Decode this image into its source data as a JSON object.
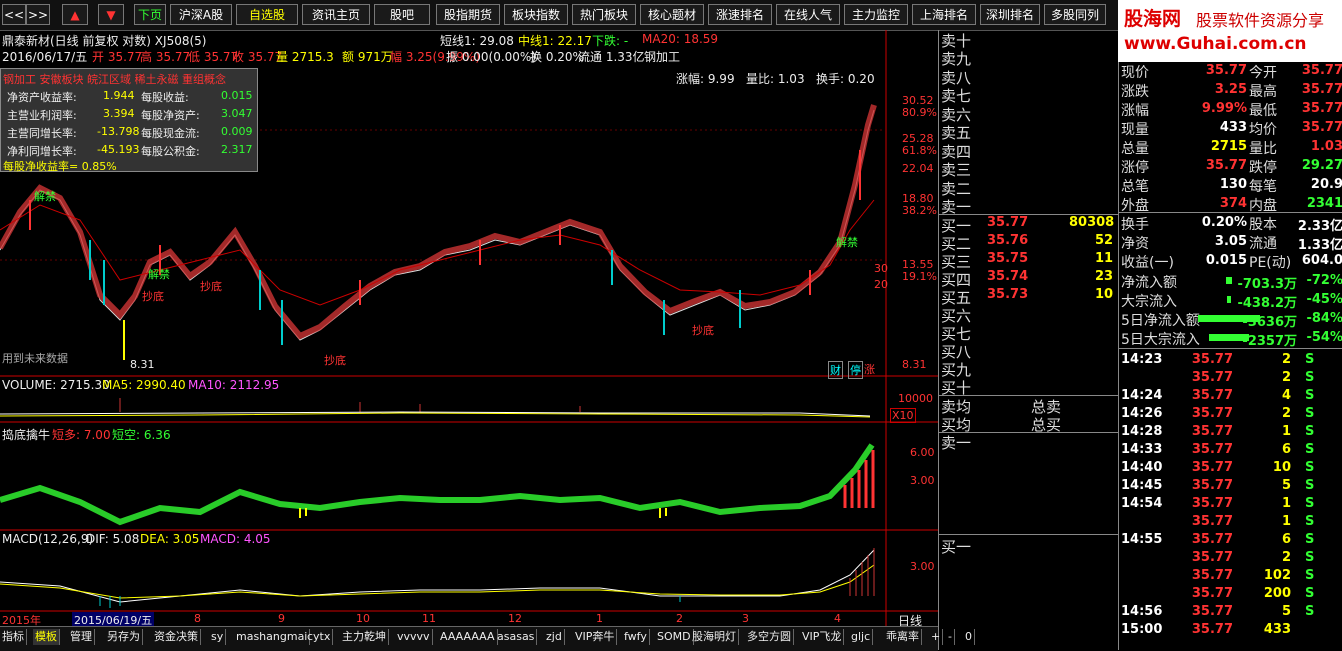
{
  "toolbar": {
    "nav_left": "<<",
    "nav_right": ">>",
    "up": "▲",
    "down": "▼",
    "buttons": [
      "下页",
      "沪深A股",
      "自选股",
      "资讯主页",
      "股吧",
      "股指期货",
      "板块指数",
      "热门板块",
      "核心题材",
      "涨速排名",
      "在线人气",
      "主力监控",
      "上海排名",
      "深圳排名",
      "多股同列"
    ]
  },
  "logo": {
    "brand": "股海网",
    "slogan": "股票软件资源分享",
    "url": "www.Guhai.com.cn"
  },
  "chart": {
    "title": "鼎泰新材(日线 前复权 对数) XJ508(5)",
    "short_line": "短线1: 29.08",
    "mid_line": "中线1: 22.17",
    "down": "下跌: -",
    "ma20": "MA20: 18.59",
    "date_line": "2016/06/17/五",
    "open": "开 35.77",
    "high": "高 35.77",
    "low": "低 35.77",
    "close": "收 35.77",
    "volume_hand": "量 2715.3",
    "amount": "额 971万",
    "range": "幅 3.25(9.99%)",
    "amplitude": "振 0.00(0.00%)",
    "turnover": "换 0.20%",
    "float": "流通 1.33亿",
    "concept": "钢加工",
    "change_rate": "涨幅: 9.99",
    "volume_ratio": "量比: 1.03",
    "turnover2": "换手: 0.20",
    "price_scale": [
      "30.52",
      "25.28",
      "22.04",
      "18.80",
      "13.55",
      "8.31"
    ],
    "pct_scale": [
      "80.9%",
      "61.8%",
      "38.2%",
      "19.1%"
    ],
    "mini_scale": [
      "30",
      "20"
    ],
    "future_note": "用到未来数据",
    "low_mark": "8.31",
    "signals": [
      "解禁",
      "抄底",
      "解禁",
      "抄底",
      "抄底",
      "抄底",
      "解禁"
    ],
    "cai": "财",
    "ting": "停",
    "zhang": "涨",
    "volume_line": "VOLUME: 2715.30",
    "ma5": "MA5: 2990.40",
    "ma10": "MA10: 2112.95",
    "vol_scale": "10000",
    "vol_x": "X10",
    "ind_name": "捣底擒牛",
    "long_short": "短多: 7.00",
    "short_empty": "短空: 6.36",
    "ind_scale": [
      "6.00",
      "3.00"
    ],
    "macd_line": "MACD(12,26,9)",
    "dif": "DIF: 5.08",
    "dea": "DEA: 3.05",
    "macd": "MACD: 4.05",
    "macd_scale": "3.00",
    "x_year": "2015年",
    "x_date": "2015/06/19/五",
    "x_months": [
      "8",
      "9",
      "10",
      "11",
      "12",
      "1",
      "2",
      "3",
      "4"
    ],
    "period": "日线"
  },
  "fin": {
    "header": "钢加工 安徽板块 皖江区域 稀土永磁 重组概念",
    "rows": [
      [
        "净资产收益率:",
        "1.944",
        "每股收益:",
        "0.015"
      ],
      [
        "主营业利润率:",
        "3.394",
        "每股净资产:",
        "3.047"
      ],
      [
        "主营同增长率:",
        "-13.798",
        "每股现金流:",
        "0.009"
      ],
      [
        "净利同增长率:",
        "-45.193",
        "每股公积金:",
        "2.317"
      ]
    ],
    "footer": "每股净收益率= 0.85%"
  },
  "book": {
    "sell_labels": [
      "卖十",
      "卖九",
      "卖八",
      "卖七",
      "卖六",
      "卖五",
      "卖四",
      "卖三",
      "卖二",
      "卖一"
    ],
    "buy_labels": [
      "买一",
      "买二",
      "买三",
      "买四",
      "买五",
      "买六",
      "买七",
      "买八",
      "买九",
      "买十"
    ],
    "buy_prices": [
      "35.77",
      "35.76",
      "35.75",
      "35.74",
      "35.73"
    ],
    "buy_vols": [
      "80308",
      "52",
      "11",
      "23",
      "10"
    ],
    "avg_sell": "卖均",
    "avg_buy": "买均",
    "total_sell": "总卖",
    "total_buy": "总买",
    "mini_sell": "卖一",
    "mini_buy": "买一"
  },
  "quote": {
    "rows": [
      [
        "现价",
        "35.77",
        "今开",
        "35.77"
      ],
      [
        "涨跌",
        "3.25",
        "最高",
        "35.77"
      ],
      [
        "涨幅",
        "9.99%",
        "最低",
        "35.77"
      ],
      [
        "现量",
        "433",
        "均价",
        "35.77"
      ],
      [
        "总量",
        "2715",
        "量比",
        "1.03"
      ],
      [
        "涨停",
        "35.77",
        "跌停",
        "29.27"
      ],
      [
        "总笔",
        "130",
        "每笔",
        "20.9"
      ],
      [
        "外盘",
        "374",
        "内盘",
        "2341"
      ],
      [
        "换手",
        "0.20%",
        "股本",
        "2.33亿"
      ],
      [
        "净资",
        "3.05",
        "流通",
        "1.33亿"
      ],
      [
        "收益(一)",
        "0.015",
        "PE(动)",
        "604.0"
      ]
    ],
    "flows": [
      [
        "净流入额",
        "-703.3万",
        "-72%"
      ],
      [
        "大宗流入",
        "-438.2万",
        "-45%"
      ],
      [
        "5日净流入额",
        "-3636万",
        "-84%"
      ],
      [
        "5日大宗流入",
        "-2357万",
        "-54%"
      ]
    ],
    "ticks": [
      [
        "14:23",
        "35.77",
        "2",
        "S"
      ],
      [
        "",
        "35.77",
        "2",
        "S"
      ],
      [
        "14:24",
        "35.77",
        "4",
        "S"
      ],
      [
        "14:26",
        "35.77",
        "2",
        "S"
      ],
      [
        "14:28",
        "35.77",
        "1",
        "S"
      ],
      [
        "14:33",
        "35.77",
        "6",
        "S"
      ],
      [
        "14:40",
        "35.77",
        "10",
        "S"
      ],
      [
        "14:45",
        "35.77",
        "5",
        "S"
      ],
      [
        "14:54",
        "35.77",
        "1",
        "S"
      ],
      [
        "",
        "35.77",
        "1",
        "S"
      ],
      [
        "14:55",
        "35.77",
        "6",
        "S"
      ],
      [
        "",
        "35.77",
        "2",
        "S"
      ],
      [
        "",
        "35.77",
        "102",
        "S"
      ],
      [
        "",
        "35.77",
        "200",
        "S"
      ],
      [
        "14:56",
        "35.77",
        "5",
        "S"
      ],
      [
        "15:00",
        "35.77",
        "433",
        ""
      ]
    ]
  },
  "bottom": {
    "tabs": [
      "指标",
      "模板",
      "管理",
      "另存为",
      "资金决策",
      "sy",
      "mashangmai",
      "cytx",
      "主力乾坤",
      "vvvvv",
      "AAAAAAA",
      "asasas",
      "zjd",
      "VIP奔牛",
      "fwfy",
      "SOMD",
      "股海明灯",
      "多空方圆",
      "VIP飞龙",
      "gljc",
      "乖离率",
      "+",
      "-",
      "0"
    ]
  }
}
